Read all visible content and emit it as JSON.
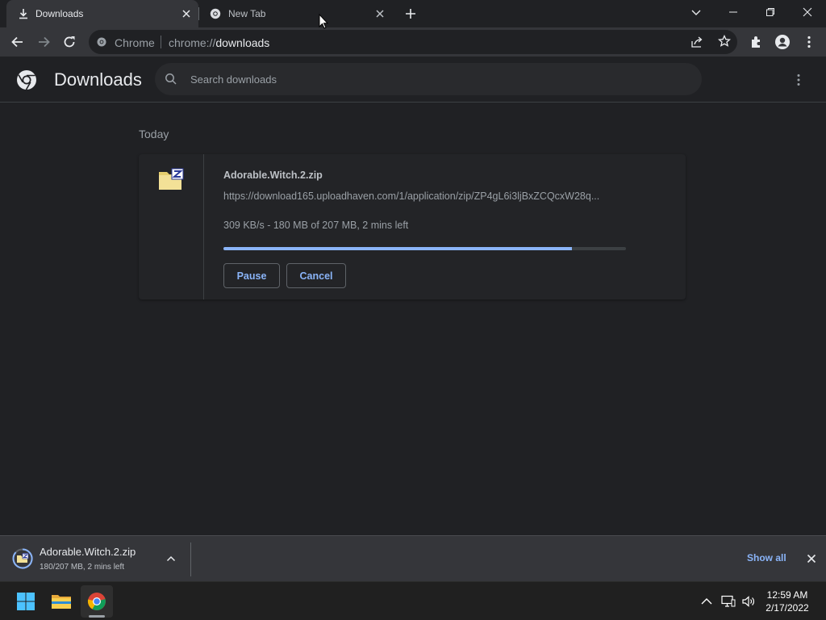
{
  "tabs": [
    {
      "title": "Downloads",
      "icon": "download-icon",
      "active": true
    },
    {
      "title": "New Tab",
      "icon": "chrome-icon",
      "active": false
    }
  ],
  "toolbar": {
    "chip_label": "Chrome",
    "url_scheme": "chrome://",
    "url_host": "downloads"
  },
  "page": {
    "title": "Downloads",
    "search_placeholder": "Search downloads",
    "date_group": "Today"
  },
  "download": {
    "file_name": "Adorable.Witch.2.zip",
    "url": "https://download165.uploadhaven.com/1/application/zip/ZP4gL6i3ljBxZCQcxW28q...",
    "status": "309 KB/s - 180 MB of 207 MB, 2 mins left",
    "progress_fraction": 0.866,
    "pause_label": "Pause",
    "cancel_label": "Cancel"
  },
  "shelf": {
    "file_name": "Adorable.Witch.2.zip",
    "status": "180/207 MB, 2 mins left",
    "show_all_label": "Show all"
  },
  "taskbar": {
    "time": "12:59 AM",
    "date": "2/17/2022"
  },
  "colors": {
    "accent": "#8ab4f8",
    "background": "#202124",
    "surface": "#35363a"
  }
}
